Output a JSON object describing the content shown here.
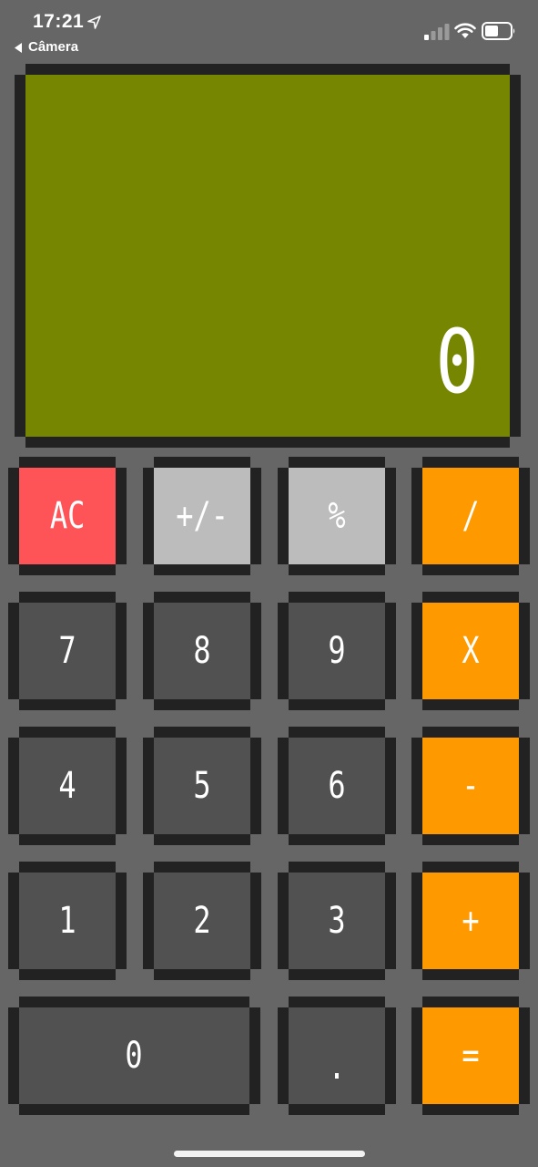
{
  "status_bar": {
    "time": "17:21",
    "back_label": "Câmera",
    "icons": [
      "location-arrow-icon",
      "signal-icon",
      "wifi-icon",
      "battery-icon"
    ]
  },
  "display": {
    "value": "0",
    "background": "#768600"
  },
  "keys": {
    "ac": "AC",
    "plus_minus": "+/-",
    "percent": "%",
    "divide": "/",
    "seven": "7",
    "eight": "8",
    "nine": "9",
    "multiply": "X",
    "four": "4",
    "five": "5",
    "six": "6",
    "subtract": "-",
    "one": "1",
    "two": "2",
    "three": "3",
    "add": "+",
    "zero": "0",
    "decimal": ".",
    "equals": "="
  },
  "colors": {
    "background": "#666666",
    "key_dark": "#515151",
    "key_red": "#ff5457",
    "key_light": "#bcbcbc",
    "key_orange": "#ff9900",
    "border": "#222222"
  }
}
